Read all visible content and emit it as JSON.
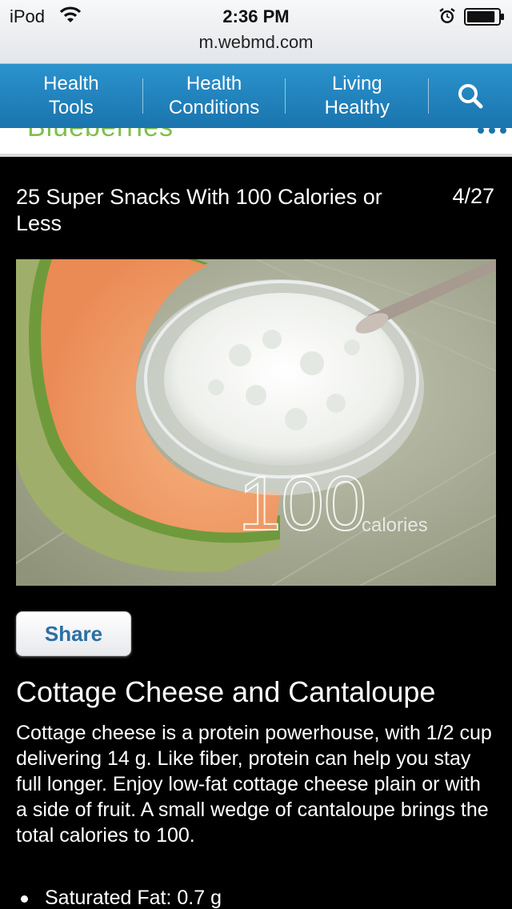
{
  "status_bar": {
    "carrier": "iPod",
    "time": "2:36 PM",
    "wifi_icon": "wifi-icon",
    "alarm_icon": "alarm-clock-icon",
    "battery_icon": "battery-icon",
    "battery_level": 0.9
  },
  "url_bar": {
    "url": "m.webmd.com"
  },
  "nav": {
    "items": [
      {
        "line1": "Health",
        "line2": "Tools"
      },
      {
        "line1": "Health",
        "line2": "Conditions"
      },
      {
        "line1": "Living",
        "line2": "Healthy"
      }
    ],
    "search_icon": "search-icon",
    "color_top": "#2b93cd",
    "color_bottom": "#1a74ad"
  },
  "strip": {
    "partial_text": "Blueberries"
  },
  "slideshow": {
    "title": "25 Super Snacks With 100 Calories or Less",
    "counter": "4/27",
    "photo": {
      "big_number": "100",
      "unit": "calories"
    },
    "share_label": "Share",
    "item_title": "Cottage Cheese and Cantaloupe",
    "item_body": "Cottage cheese is a protein powerhouse, with 1/2 cup delivering 14 g. Like fiber, protein can help you stay full longer. Enjoy low-fat cottage cheese plain or with a side of fruit. A small wedge of cantaloupe brings the total calories to 100.",
    "nutrition": [
      "Saturated Fat: 0.7 g"
    ]
  }
}
